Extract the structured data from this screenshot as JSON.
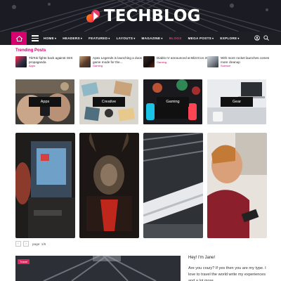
{
  "logo": {
    "text": "TECHBLOG",
    "brand_colors": [
      "#ff2b4f",
      "#ff8a00"
    ]
  },
  "nav": {
    "items": [
      {
        "label": "HOME",
        "has_caret": true
      },
      {
        "label": "HEADERS",
        "has_caret": true
      },
      {
        "label": "FEATURED",
        "has_caret": true
      },
      {
        "label": "LAYOUTS",
        "has_caret": true
      },
      {
        "label": "MAGAZINE",
        "has_caret": true
      },
      {
        "label": "BLOGS",
        "has_caret": false,
        "active": true
      },
      {
        "label": "MEGA POSTS",
        "has_caret": true
      },
      {
        "label": "EXPLORE",
        "has_caret": true
      }
    ],
    "caret": "▾",
    "accent": "#d6006f"
  },
  "trending": {
    "title": "Trending Posts",
    "items": [
      {
        "headline": "TikTok fights back against ISIS propaganda",
        "category": "Apps"
      },
      {
        "headline": "Apex Legends is launching a duos game mode for the...",
        "category": "Gaming"
      },
      {
        "headline": "Diablo IV announced at BlizzCon 2019",
        "category": "Gaming"
      },
      {
        "headline": "With more rocket launches comes more cleanup",
        "category": "Science"
      }
    ]
  },
  "categories": [
    {
      "label": "Apps"
    },
    {
      "label": "Creative"
    },
    {
      "label": "Gaming"
    },
    {
      "label": "Gear"
    }
  ],
  "pagination": {
    "prev": "‹",
    "next": "›",
    "text": "page: 1/6"
  },
  "bottom": {
    "badge": "Travel",
    "about_title": "Hey! I'm Jane!",
    "about_body": "Are you crazy? If yes then you are my type. I love to travel the world write my experiences and a lot more..."
  }
}
